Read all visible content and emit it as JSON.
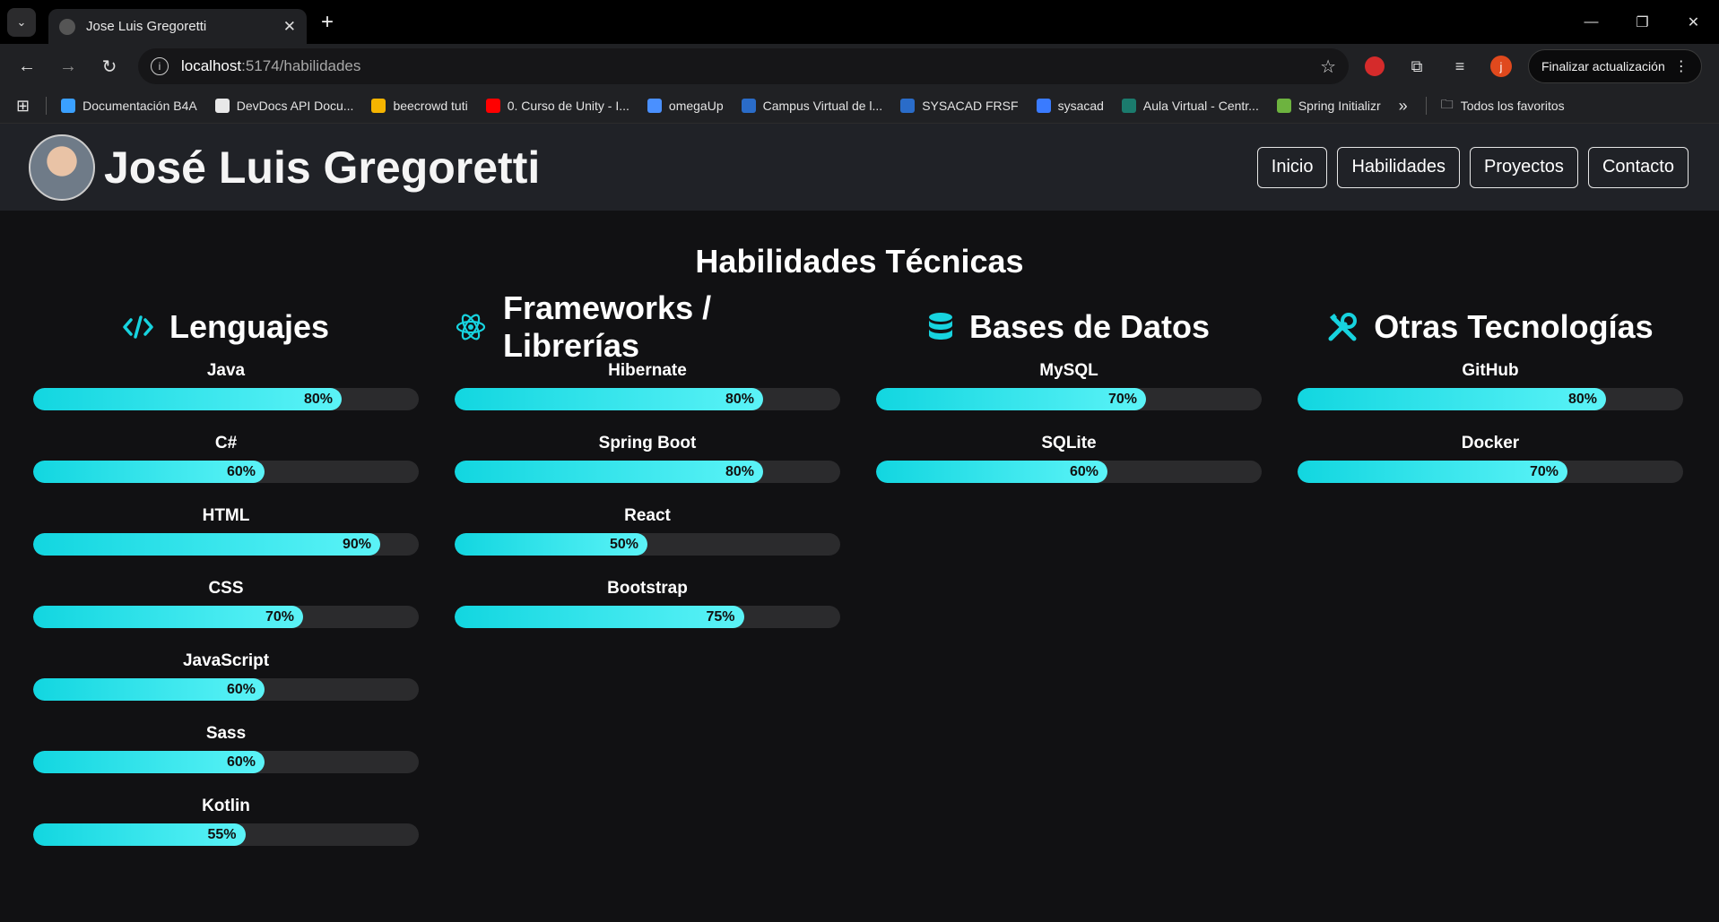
{
  "browser": {
    "tab_title": "Jose Luis Gregoretti",
    "url_host": "localhost",
    "url_path": ":5174/habilidades",
    "update_button": "Finalizar actualización",
    "avatar_letter": "j",
    "bookmarks": [
      {
        "label": "Documentación B4A",
        "color": "#3aa0ff"
      },
      {
        "label": "DevDocs API Docu...",
        "color": "#e8e8e8"
      },
      {
        "label": "beecrowd tuti",
        "color": "#f5b400"
      },
      {
        "label": "0. Curso de Unity - I...",
        "color": "#ff0000"
      },
      {
        "label": "omegaUp",
        "color": "#4a90ff"
      },
      {
        "label": "Campus Virtual de l...",
        "color": "#2a6cc9"
      },
      {
        "label": "SYSACAD FRSF",
        "color": "#2a6cc9"
      },
      {
        "label": "sysacad",
        "color": "#3a7bff"
      },
      {
        "label": "Aula Virtual - Centr...",
        "color": "#1b7b6d"
      },
      {
        "label": "Spring Initializr",
        "color": "#6db33f"
      }
    ],
    "more_bookmarks": "»",
    "all_favorites": "Todos los favoritos"
  },
  "header": {
    "site_title": "José Luis Gregoretti",
    "nav": [
      "Inicio",
      "Habilidades",
      "Proyectos",
      "Contacto"
    ]
  },
  "main": {
    "title": "Habilidades Técnicas",
    "categories": [
      {
        "title": "Lenguajes",
        "icon": "code-icon",
        "skills": [
          {
            "name": "Java",
            "level": 80,
            "label": "80%"
          },
          {
            "name": "C#",
            "level": 60,
            "label": "60%"
          },
          {
            "name": "HTML",
            "level": 90,
            "label": "90%"
          },
          {
            "name": "CSS",
            "level": 70,
            "label": "70%"
          },
          {
            "name": "JavaScript",
            "level": 60,
            "label": "60%"
          },
          {
            "name": "Sass",
            "level": 60,
            "label": "60%"
          },
          {
            "name": "Kotlin",
            "level": 55,
            "label": "55%"
          }
        ]
      },
      {
        "title": "Frameworks / Librerías",
        "icon": "react-icon",
        "skills": [
          {
            "name": "Hibernate",
            "level": 80,
            "label": "80%"
          },
          {
            "name": "Spring Boot",
            "level": 80,
            "label": "80%"
          },
          {
            "name": "React",
            "level": 50,
            "label": "50%"
          },
          {
            "name": "Bootstrap",
            "level": 75,
            "label": "75%"
          }
        ]
      },
      {
        "title": "Bases de Datos",
        "icon": "database-icon",
        "skills": [
          {
            "name": "MySQL",
            "level": 70,
            "label": "70%"
          },
          {
            "name": "SQLite",
            "level": 60,
            "label": "60%"
          }
        ]
      },
      {
        "title": "Otras Tecnologías",
        "icon": "tools-icon",
        "skills": [
          {
            "name": "GitHub",
            "level": 80,
            "label": "80%"
          },
          {
            "name": "Docker",
            "level": 70,
            "label": "70%"
          }
        ]
      }
    ]
  },
  "colors": {
    "accent": "#17d3df",
    "bar_track": "#2b2b2d",
    "header_bg": "#202227",
    "page_bg": "#111113"
  }
}
